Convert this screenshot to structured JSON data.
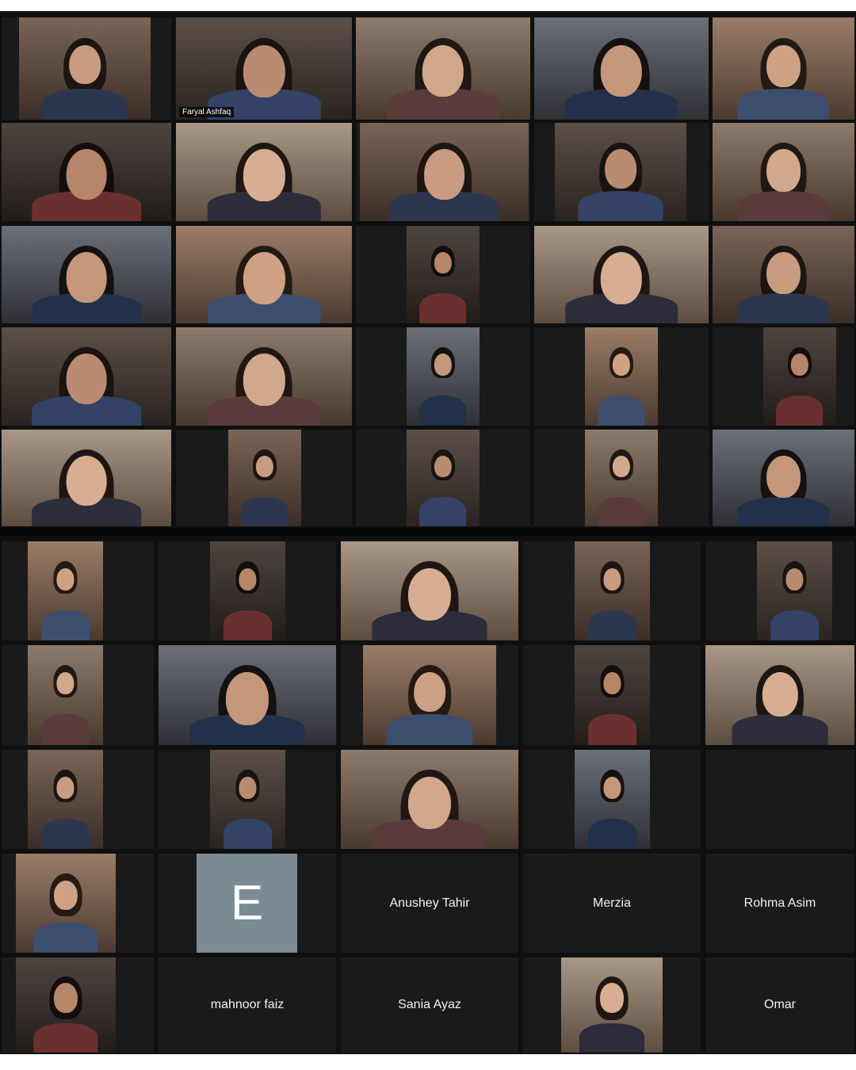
{
  "meeting": {
    "active_speaker": "Faryal Ashfaq",
    "avatar_initial": "E",
    "named_participants": [
      "Anushey Tahir",
      "Merzia",
      "Rohma Asim",
      "mahnoor faiz",
      "Sania Ayaz",
      "Omar"
    ]
  },
  "colors": {
    "background": "#0f0f0f",
    "tile": "#1a1a1a",
    "active_speaker_border": "#c9d44a",
    "avatar": "#7b8a93"
  }
}
